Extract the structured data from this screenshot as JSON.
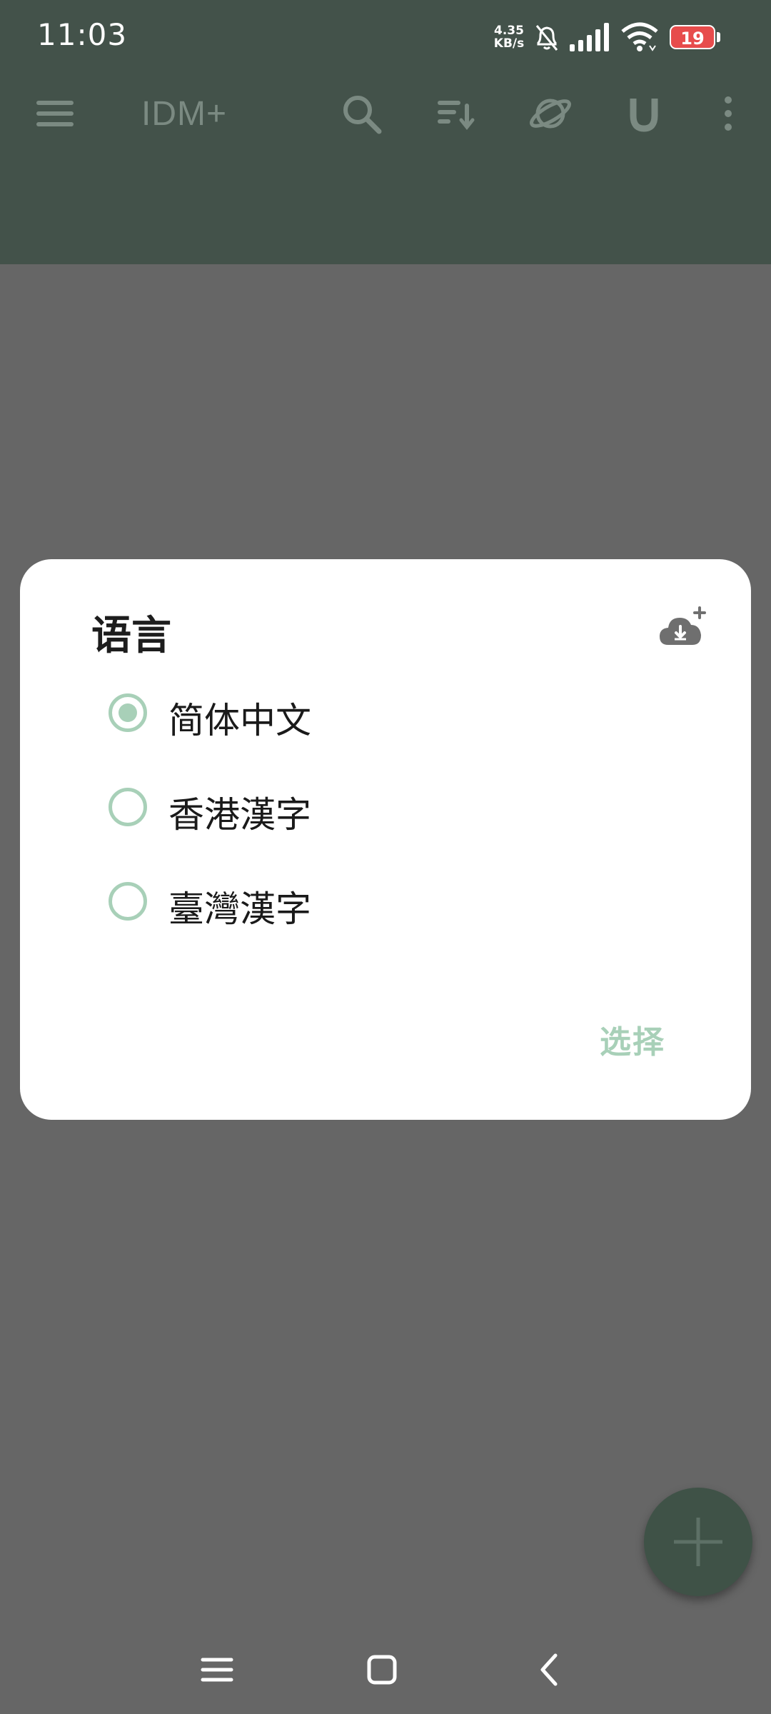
{
  "status_bar": {
    "time": "11:03",
    "net_speed_value": "4.35",
    "net_speed_unit": "KB/s",
    "battery": "19",
    "icons": [
      "bell-off-icon",
      "signal-icon",
      "wifi-icon",
      "battery-icon"
    ]
  },
  "toolbar": {
    "app_title": "IDM+",
    "icons": [
      "menu-icon",
      "search-icon",
      "sort-icon",
      "browser-planet-icon",
      "magnet-icon",
      "more-vert-icon"
    ]
  },
  "dialog": {
    "title": "语言",
    "download_icon": "cloud-download-add-icon",
    "options": [
      {
        "label": "简体中文",
        "selected": true
      },
      {
        "label": "香港漢字",
        "selected": false
      },
      {
        "label": "臺灣漢字",
        "selected": false
      }
    ],
    "confirm_label": "选择"
  },
  "fab": {
    "icon": "plus-icon"
  },
  "nav_bar": {
    "icons": [
      "recents-menu-icon",
      "home-square-icon",
      "back-chevron-icon"
    ]
  },
  "colors": {
    "scrim": "#666666",
    "appbar": "#43524a",
    "accent": "#a8d0b8",
    "battery_low": "#e74c4c"
  }
}
